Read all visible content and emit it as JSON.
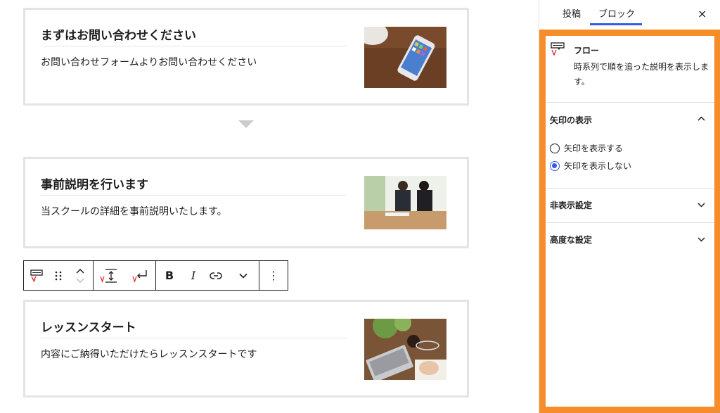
{
  "flow_items": [
    {
      "title": "まずはお問い合わせください",
      "text": "お問い合わせフォームよりお問い合わせください"
    },
    {
      "title": "事前説明を行います",
      "text": "当スクールの詳細を事前説明いたします。"
    },
    {
      "title": "レッスンスタート",
      "text": "内容にご納得いただけたらレッスンスタートです"
    }
  ],
  "toolbar": {
    "bold": "B",
    "italic": "I",
    "more": "⋮"
  },
  "sidebar": {
    "tabs": [
      "投稿",
      "ブロック"
    ],
    "active_tab": "ブロック",
    "close": "×",
    "block_name": "フロー",
    "block_description": "時系列で順を追った説明を表示します。",
    "arrow_section": {
      "title": "矢印の表示",
      "options": [
        "矢印を表示する",
        "矢印を表示しない"
      ],
      "selected": "矢印を表示しない"
    },
    "hidden_section_title": "非表示設定",
    "advanced_section_title": "高度な設定"
  },
  "colors": {
    "accent": "#3858e9",
    "highlight": "#f78c2a"
  }
}
